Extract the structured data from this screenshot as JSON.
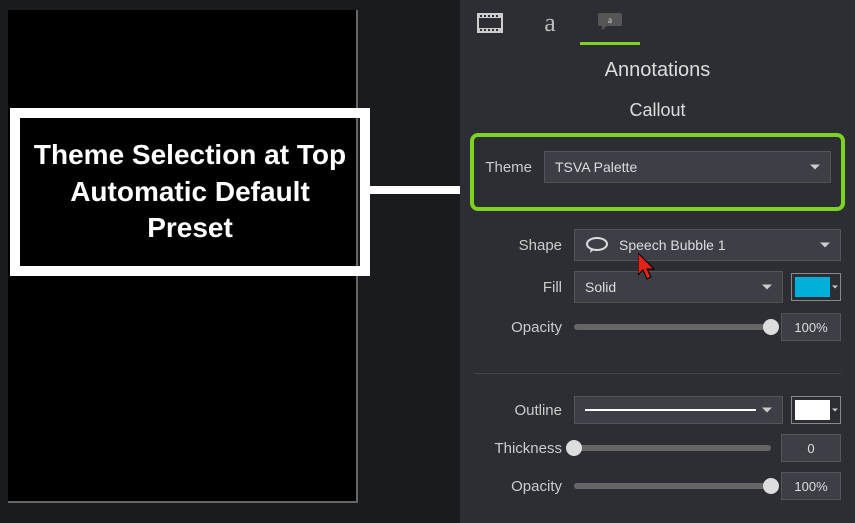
{
  "canvas": {
    "callout_text": "Theme Selection at Top Automatic Default Preset"
  },
  "panel": {
    "heading": "Annotations",
    "subheading": "Callout",
    "theme": {
      "label": "Theme",
      "value": "TSVA Palette"
    },
    "shape": {
      "label": "Shape",
      "value": "Speech Bubble 1",
      "icon": "speech-bubble-icon"
    },
    "fill": {
      "label": "Fill",
      "value": "Solid",
      "color": "#00b0d8",
      "opacity_label": "Opacity",
      "opacity_value": "100%",
      "opacity_pct": 100
    },
    "outline": {
      "label": "Outline",
      "style": "solid-line",
      "color": "#ffffff",
      "thickness_label": "Thickness",
      "thickness_value": "0",
      "thickness_pct": 0,
      "opacity_label": "Opacity",
      "opacity_value": "100%",
      "opacity_pct": 100
    }
  }
}
